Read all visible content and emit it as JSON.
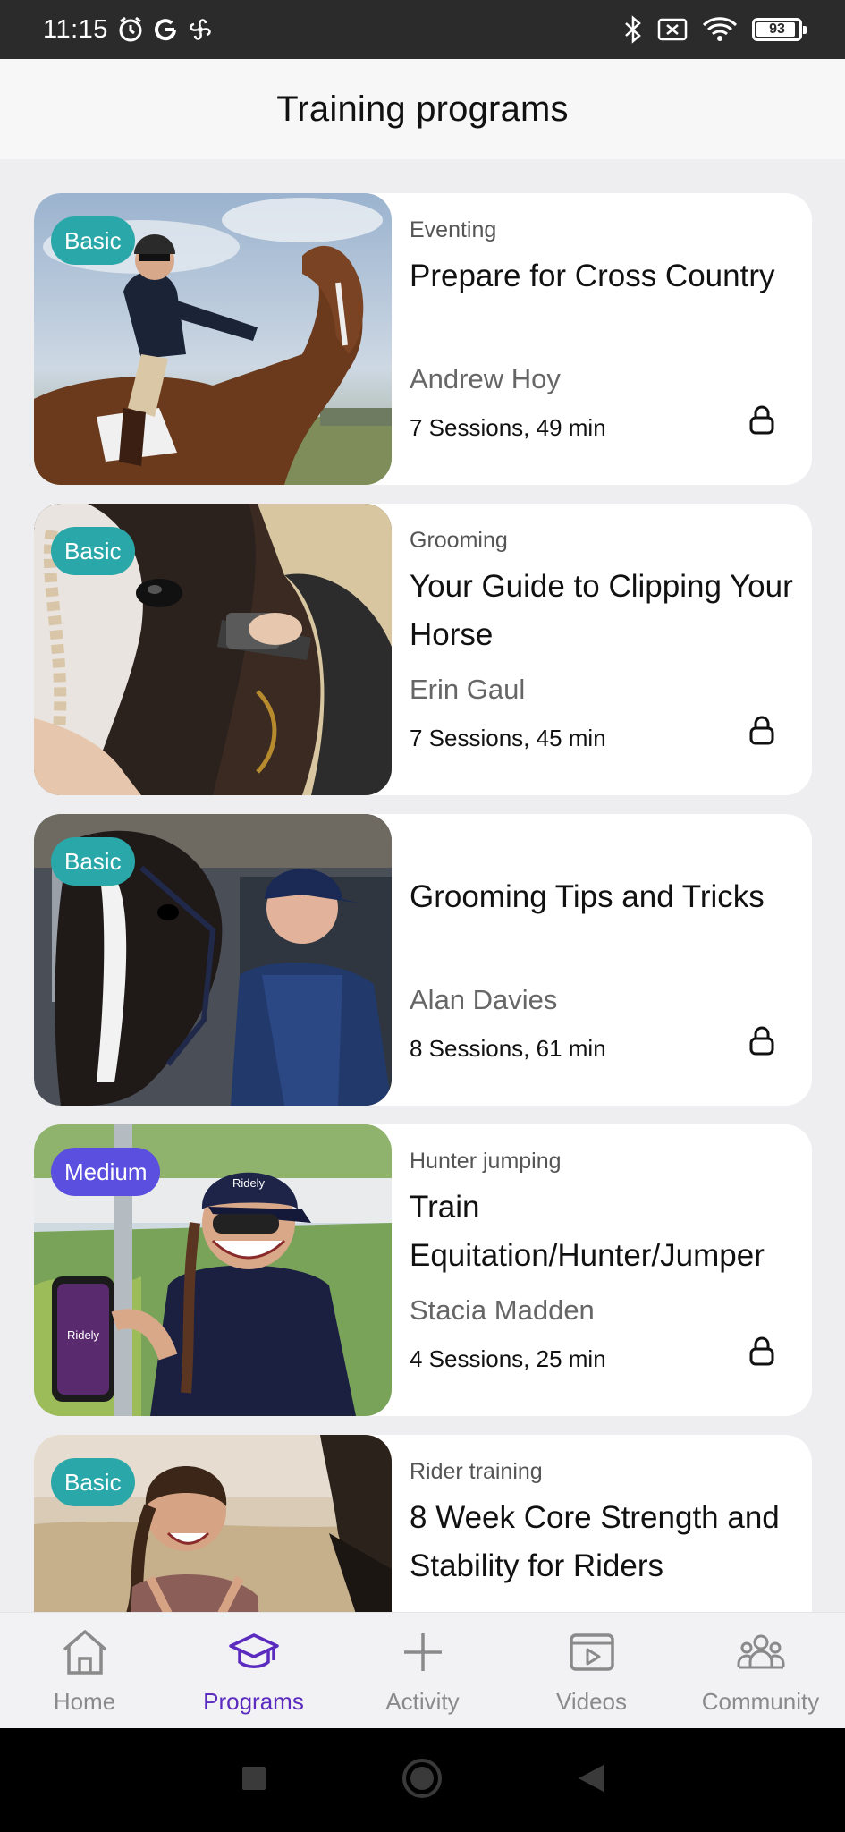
{
  "status_bar": {
    "time": "11:15",
    "battery": "93",
    "battery_level": 0.93
  },
  "header": {
    "title": "Training programs"
  },
  "colors": {
    "basic_badge": "#2aa7a9",
    "medium_badge": "#5b4fe0",
    "active_nav": "#5b2bbf"
  },
  "programs": [
    {
      "level": "Basic",
      "category": "Eventing",
      "title": "Prepare for Cross Country",
      "instructor": "Andrew Hoy",
      "sessions": "7 Sessions, 49 min",
      "locked": true
    },
    {
      "level": "Basic",
      "category": "Grooming",
      "title": "Your Guide to Clipping Your Horse",
      "instructor": "Erin Gaul",
      "sessions": "7 Sessions, 45 min",
      "locked": true
    },
    {
      "level": "Basic",
      "category": "",
      "title": "Grooming Tips and Tricks",
      "instructor": "Alan Davies",
      "sessions": "8 Sessions, 61 min",
      "locked": true
    },
    {
      "level": "Medium",
      "category": "Hunter jumping",
      "title": "Train Equitation/Hunter/Jumper",
      "instructor": "Stacia Madden",
      "sessions": "4 Sessions, 25 min",
      "locked": true,
      "phone_logo_text": "Ridely",
      "cap_logo_text": "Ridely"
    },
    {
      "level": "Basic",
      "category": "Rider training",
      "title": "8 Week Core Strength and Stability for Riders",
      "instructor": "",
      "sessions": "",
      "locked": false
    }
  ],
  "bottom_nav": [
    {
      "label": "Home",
      "icon": "home-icon",
      "active": false
    },
    {
      "label": "Programs",
      "icon": "graduation-cap-icon",
      "active": true
    },
    {
      "label": "Activity",
      "icon": "plus-icon",
      "active": false
    },
    {
      "label": "Videos",
      "icon": "video-icon",
      "active": false
    },
    {
      "label": "Community",
      "icon": "community-icon",
      "active": false
    }
  ]
}
